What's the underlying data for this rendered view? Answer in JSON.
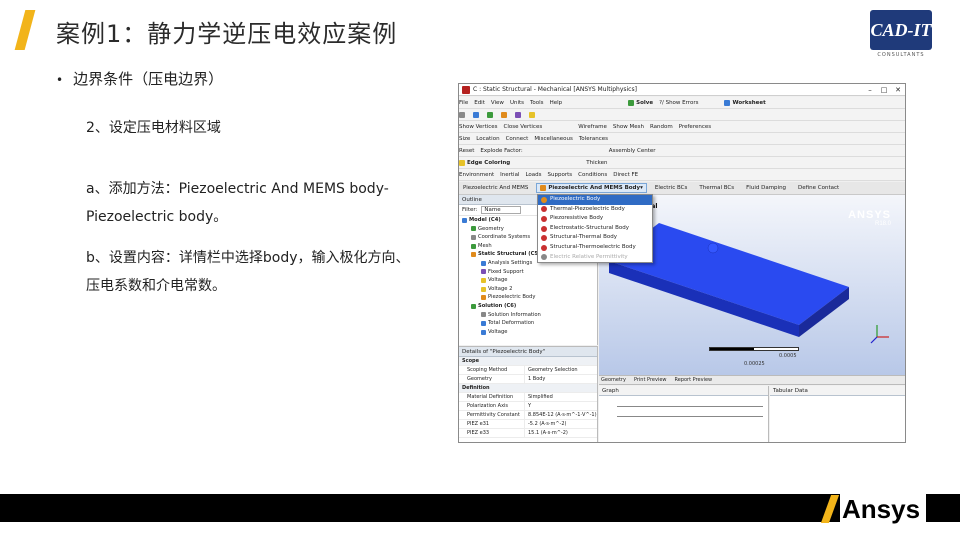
{
  "slide": {
    "title": "案例1：静力学逆压电效应案例",
    "bullet": "边界条件（压电边界）",
    "step": "2、设定压电材料区域",
    "method_line1": "a、添加方法：Piezoelectric And MEMS body-",
    "method_line2": "Piezoelectric body。",
    "settings_line1": "b、设置内容：详情栏中选择body，输入极化方向、",
    "settings_line2": "压电系数和介电常数。",
    "logo_text": "CAD-IT",
    "logo_sub": "CONSULTANTS",
    "footer_logo": "Ansys"
  },
  "colors": {
    "accent": "#f2b41a",
    "footer": "#000000",
    "highlight": "#2f6bc4",
    "model_body": "#1f3fe0"
  },
  "screenshot": {
    "window_title": "C : Static Structural - Mechanical [ANSYS Multiphysics]",
    "toolbar_row1": [
      "File",
      "Edit",
      "View",
      "Units",
      "Tools",
      "Help",
      "Solve",
      "?/ Show Errors",
      "Worksheet"
    ],
    "toolbar_row2": [
      "Show Vertices",
      "Close Vertices",
      "Wireframe",
      "Show Mesh",
      "Random",
      "Preferences"
    ],
    "toolbar_row3": [
      "Size",
      "Location",
      "Connect",
      "Miscellaneous",
      "Tolerances"
    ],
    "toolbar_row4": [
      "Reset",
      "Explode Factor:",
      "Assembly Center"
    ],
    "toolbar_row5": [
      "Edge Coloring",
      "Thicken"
    ],
    "toolbar_row6": [
      "Environment",
      "Inertial",
      "Loads",
      "Supports",
      "Conditions",
      "Direct FE"
    ],
    "context_bar": [
      "Piezoelectric And MEMS",
      "Piezoelectric And MEMS Body",
      "Electric BCs",
      "Thermal BCs",
      "Fluid Damping",
      "Define Contact"
    ],
    "outline_title": "Outline",
    "filter_label": "Filter:",
    "filter_value": "Name",
    "tree": [
      "Model (C4)",
      "Geometry",
      "Coordinate Systems",
      "Mesh",
      "Static Structural (C5)",
      "Analysis Settings",
      "Fixed Support",
      "Voltage",
      "Voltage 2",
      "Piezoelectric Body",
      "Solution (C6)",
      "Solution Information",
      "Total Deformation",
      "Voltage"
    ],
    "dropdown": [
      {
        "label": "Piezoelectric Body",
        "highlighted": true
      },
      {
        "label": "Thermal-Piezoelectric Body",
        "highlighted": false
      },
      {
        "label": "Piezoresistive Body",
        "highlighted": false
      },
      {
        "label": "Electrostatic-Structural Body",
        "highlighted": false
      },
      {
        "label": "Structural-Thermal Body",
        "highlighted": false
      },
      {
        "label": "Structural-Thermoelectric Body",
        "highlighted": false
      },
      {
        "label": "Electric Relative Permittivity",
        "highlighted": false
      }
    ],
    "viewport_label": "ual",
    "brand": "ANSYS",
    "release": "R18.0",
    "scale_end": "0.0005",
    "scale_mid": "0.00025",
    "details_title": "Details of \"Piezoelectric Body\"",
    "details": [
      {
        "group": "Scope"
      },
      {
        "k": "Scoping Method",
        "v": "Geometry Selection"
      },
      {
        "k": "Geometry",
        "v": "1 Body"
      },
      {
        "group": "Definition"
      },
      {
        "k": "Material Definition",
        "v": "Simplified"
      },
      {
        "k": "Polarization Axis",
        "v": "Y"
      },
      {
        "k": "Permittivity Constant",
        "v": "8.854E-12 (A·s·m^-1·V^-1)"
      },
      {
        "k": "PIEZ e31",
        "v": "-5.2 (A·s·m^-2)"
      },
      {
        "k": "PIEZ e33",
        "v": "15.1 (A·s·m^-2)"
      }
    ],
    "viewport_tabs": [
      "Geometry",
      "Print Preview",
      "Report Preview"
    ],
    "graph_title": "Graph",
    "tabular_title": "Tabular Data"
  }
}
